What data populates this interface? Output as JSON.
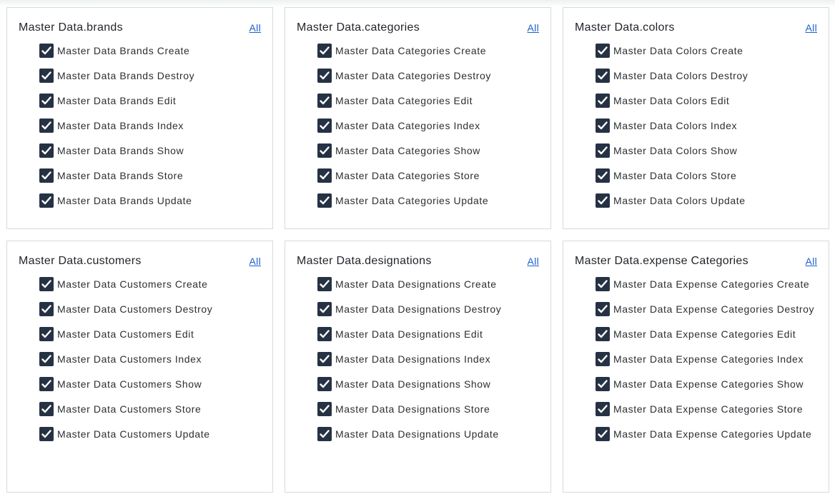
{
  "all_label": "All",
  "cards": [
    {
      "title": "Master Data.brands",
      "items": [
        "Master Data Brands Create",
        "Master Data Brands Destroy",
        "Master Data Brands Edit",
        "Master Data Brands Index",
        "Master Data Brands Show",
        "Master Data Brands Store",
        "Master Data Brands Update"
      ]
    },
    {
      "title": "Master Data.categories",
      "items": [
        "Master Data Categories Create",
        "Master Data Categories Destroy",
        "Master Data Categories Edit",
        "Master Data Categories Index",
        "Master Data Categories Show",
        "Master Data Categories Store",
        "Master Data Categories Update"
      ]
    },
    {
      "title": "Master Data.colors",
      "items": [
        "Master Data Colors Create",
        "Master Data Colors Destroy",
        "Master Data Colors Edit",
        "Master Data Colors Index",
        "Master Data Colors Show",
        "Master Data Colors Store",
        "Master Data Colors Update"
      ]
    },
    {
      "title": "Master Data.customers",
      "items": [
        "Master Data Customers Create",
        "Master Data Customers Destroy",
        "Master Data Customers Edit",
        "Master Data Customers Index",
        "Master Data Customers Show",
        "Master Data Customers Store",
        "Master Data Customers Update"
      ]
    },
    {
      "title": "Master Data.designations",
      "items": [
        "Master Data Designations Create",
        "Master Data Designations Destroy",
        "Master Data Designations Edit",
        "Master Data Designations Index",
        "Master Data Designations Show",
        "Master Data Designations Store",
        "Master Data Designations Update"
      ]
    },
    {
      "title": "Master Data.expense Categories",
      "items": [
        "Master Data Expense Categories Create",
        "Master Data Expense Categories Destroy",
        "Master Data Expense Categories Edit",
        "Master Data Expense Categories Index",
        "Master Data Expense Categories Show",
        "Master Data Expense Categories Store",
        "Master Data Expense Categories Update"
      ]
    }
  ],
  "colors": {
    "checkbox_fill": "#263244",
    "link": "#1a5fd0"
  },
  "checkbox_icon": "check-icon",
  "all_checked": true
}
